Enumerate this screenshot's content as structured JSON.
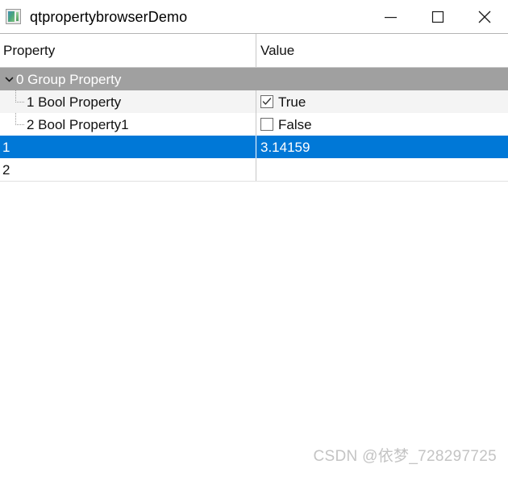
{
  "window": {
    "title": "qtpropertybrowserDemo",
    "icon": "application-image-icon",
    "controls": {
      "minimize": "minimize-icon",
      "maximize": "maximize-icon",
      "close": "close-icon"
    }
  },
  "colors": {
    "selection": "#0078D7",
    "group_row": "#A0A0A0",
    "alt_row": "#F4F4F4",
    "grid_line": "#C8C8C8",
    "watermark": "#C4C4C4"
  },
  "table": {
    "headers": {
      "property": "Property",
      "value": "Value"
    },
    "rows": [
      {
        "property": "0 Group Property",
        "value": "",
        "kind": "group",
        "expanded": true,
        "expander": "chevron-down-icon"
      },
      {
        "property": "1 Bool Property",
        "value": "True",
        "kind": "bool",
        "checked": true
      },
      {
        "property": "2 Bool Property1",
        "value": "False",
        "kind": "bool",
        "checked": false
      },
      {
        "property": "1",
        "value": "3.14159",
        "kind": "value",
        "selected": true
      },
      {
        "property": "2",
        "value": "",
        "kind": "value",
        "selected": false
      }
    ]
  },
  "watermark": {
    "text": "CSDN @依梦_728297725"
  }
}
